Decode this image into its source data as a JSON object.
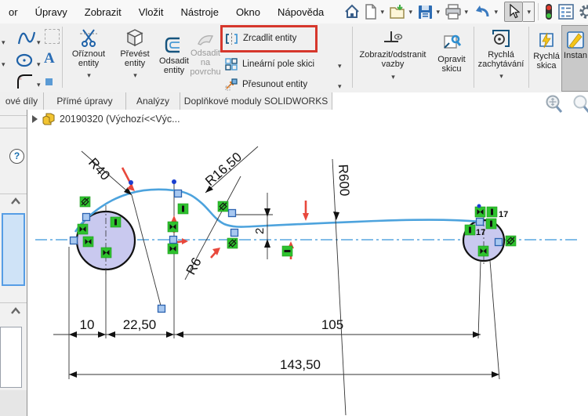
{
  "window": {
    "menu_items": [
      "or",
      "Úpravy",
      "Zobrazit",
      "Vložit",
      "Nástroje",
      "Okno",
      "Nápověda"
    ]
  },
  "glyphs": {
    "dropdown": "▾"
  },
  "ribbon": {
    "trim": {
      "line1": "Oříznout",
      "line2": "entity"
    },
    "convert": {
      "line1": "Převést",
      "line2": "entity"
    },
    "offset": {
      "line1": "Odsadit",
      "line2": "entity"
    },
    "offset_surface": {
      "line1": "Odsadit",
      "line2": "na",
      "line3": "povrchu"
    },
    "mirror_label": "Zrcadlit entity",
    "linear_pattern_label": "Lineární pole skici",
    "move_label": "Přesunout entity",
    "relations": {
      "line1": "Zobrazit/odstranit",
      "line2": "vazby"
    },
    "repair": {
      "line1": "Opravit",
      "line2": "skicu"
    },
    "snaps": {
      "line1": "Rychlá",
      "line2": "zachytávání"
    },
    "rapid": {
      "line1": "Rychlá",
      "line2": "skica"
    },
    "instant_label": "Instan",
    "text_tool_label": "A"
  },
  "tabs": [
    "ové díly",
    "Přímé úpravy",
    "Analýzy",
    "Doplňkové moduly SOLIDWORKS"
  ],
  "tree": {
    "part_label": "20190320 (Výchozí<<Výc..."
  },
  "panel": {
    "help_glyph": "?"
  },
  "sketch": {
    "dim_r40": "R40",
    "dim_r16_50": "R16,50",
    "dim_r6": "R6",
    "dim_r600": "R600",
    "dim_2": "2",
    "dim_10": "10",
    "dim_22_50": "22,50",
    "dim_105": "105",
    "dim_143_50": "143,50",
    "count_17_top": "17",
    "count_17_left": "17"
  },
  "colors": {
    "sketch_blue": "#4da3dd",
    "constraint_green": "#2ec22e",
    "highlight_red": "#d6372c",
    "circle_fill": "#c9c9ef",
    "arrow_red": "#e8483c",
    "selection_box_blue": "#569de5"
  }
}
